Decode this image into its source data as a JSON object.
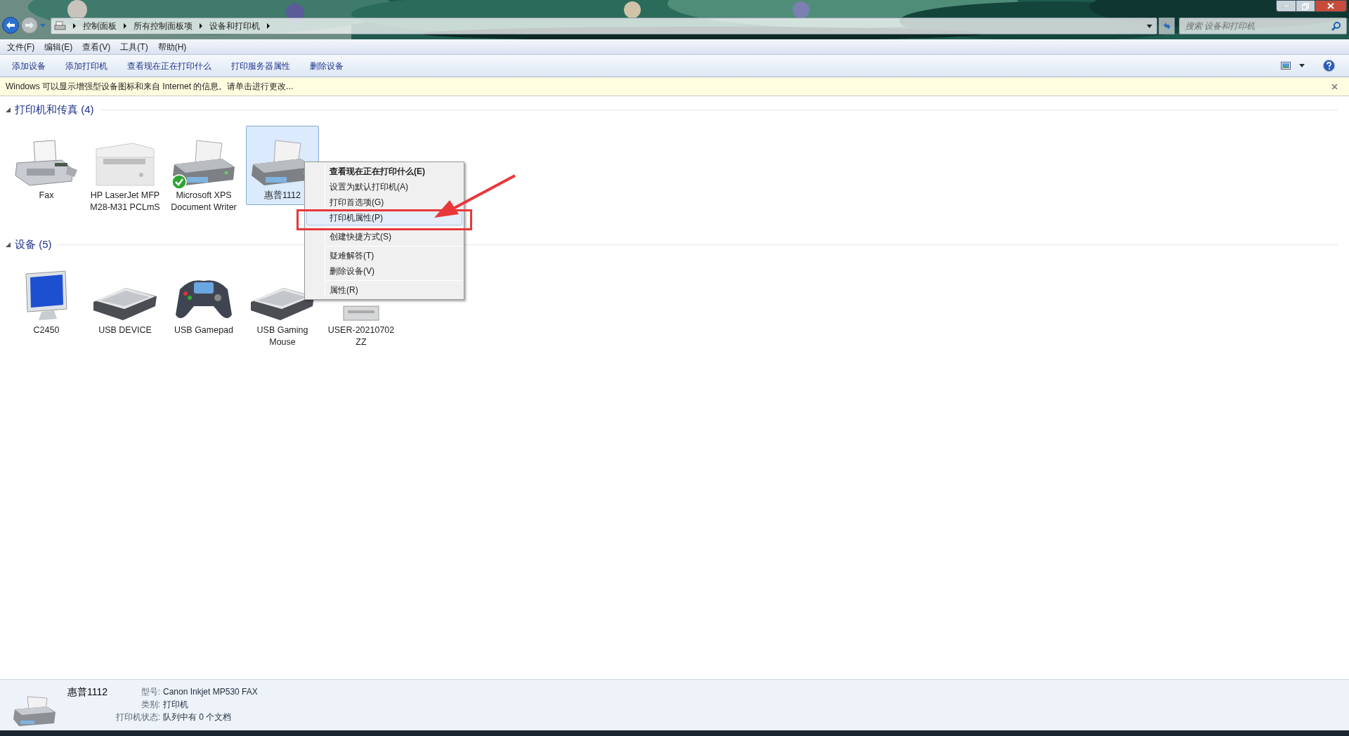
{
  "address_bar": {
    "breadcrumbs": [
      "控制面板",
      "所有控制面板项",
      "设备和打印机"
    ]
  },
  "search": {
    "placeholder": "搜索 设备和打印机"
  },
  "menu_bar": [
    "文件(F)",
    "编辑(E)",
    "查看(V)",
    "工具(T)",
    "帮助(H)"
  ],
  "toolbar": [
    "添加设备",
    "添加打印机",
    "查看现在正在打印什么",
    "打印服务器属性",
    "删除设备"
  ],
  "info_bar": {
    "text": "Windows 可以显示增强型设备图标和来自 Internet 的信息。请单击进行更改..."
  },
  "groups": [
    {
      "title": "打印机和传真 (4)",
      "expanded": true,
      "items": [
        {
          "label": "Fax",
          "kind": "fax",
          "selected": false,
          "default": false
        },
        {
          "label": "HP LaserJet MFP M28-M31 PCLmS",
          "kind": "mfp",
          "selected": false,
          "default": false
        },
        {
          "label": "Microsoft XPS Document Writer",
          "kind": "printer",
          "selected": false,
          "default": true
        },
        {
          "label": "惠普1112",
          "kind": "printer",
          "selected": true,
          "default": false
        }
      ]
    },
    {
      "title": "设备 (5)",
      "expanded": true,
      "items": [
        {
          "label": "C2450",
          "kind": "monitor",
          "selected": false,
          "default": false
        },
        {
          "label": "USB DEVICE",
          "kind": "keyboard",
          "selected": false,
          "default": false
        },
        {
          "label": "USB Gamepad",
          "kind": "gamepad",
          "selected": false,
          "default": false
        },
        {
          "label": "USB Gaming Mouse",
          "kind": "keyboard",
          "selected": false,
          "default": false
        },
        {
          "label": "USER-20210702 ZZ",
          "kind": "computer",
          "selected": false,
          "default": false
        }
      ]
    }
  ],
  "context_menu": {
    "sections": [
      {
        "items": [
          {
            "label": "查看现在正在打印什么(E)",
            "bold": true,
            "selected": false
          },
          {
            "label": "设置为默认打印机(A)",
            "bold": false,
            "selected": false
          },
          {
            "label": "打印首选项(G)",
            "bold": false,
            "selected": false
          },
          {
            "label": "打印机属性(P)",
            "bold": false,
            "selected": true
          }
        ]
      },
      {
        "items": [
          {
            "label": "创建快捷方式(S)",
            "bold": false,
            "selected": false
          }
        ]
      },
      {
        "items": [
          {
            "label": "疑难解答(T)",
            "bold": false,
            "selected": false
          },
          {
            "label": "删除设备(V)",
            "bold": false,
            "selected": false
          }
        ]
      },
      {
        "items": [
          {
            "label": "属性(R)",
            "bold": false,
            "selected": false
          }
        ]
      }
    ]
  },
  "details_pane": {
    "name": "惠普1112",
    "fields": [
      {
        "label": "型号:",
        "value": "Canon Inkjet MP530 FAX"
      },
      {
        "label": "类别:",
        "value": "打印机"
      },
      {
        "label": "打印机状态:",
        "value": "队列中有 0 个文档"
      }
    ]
  }
}
